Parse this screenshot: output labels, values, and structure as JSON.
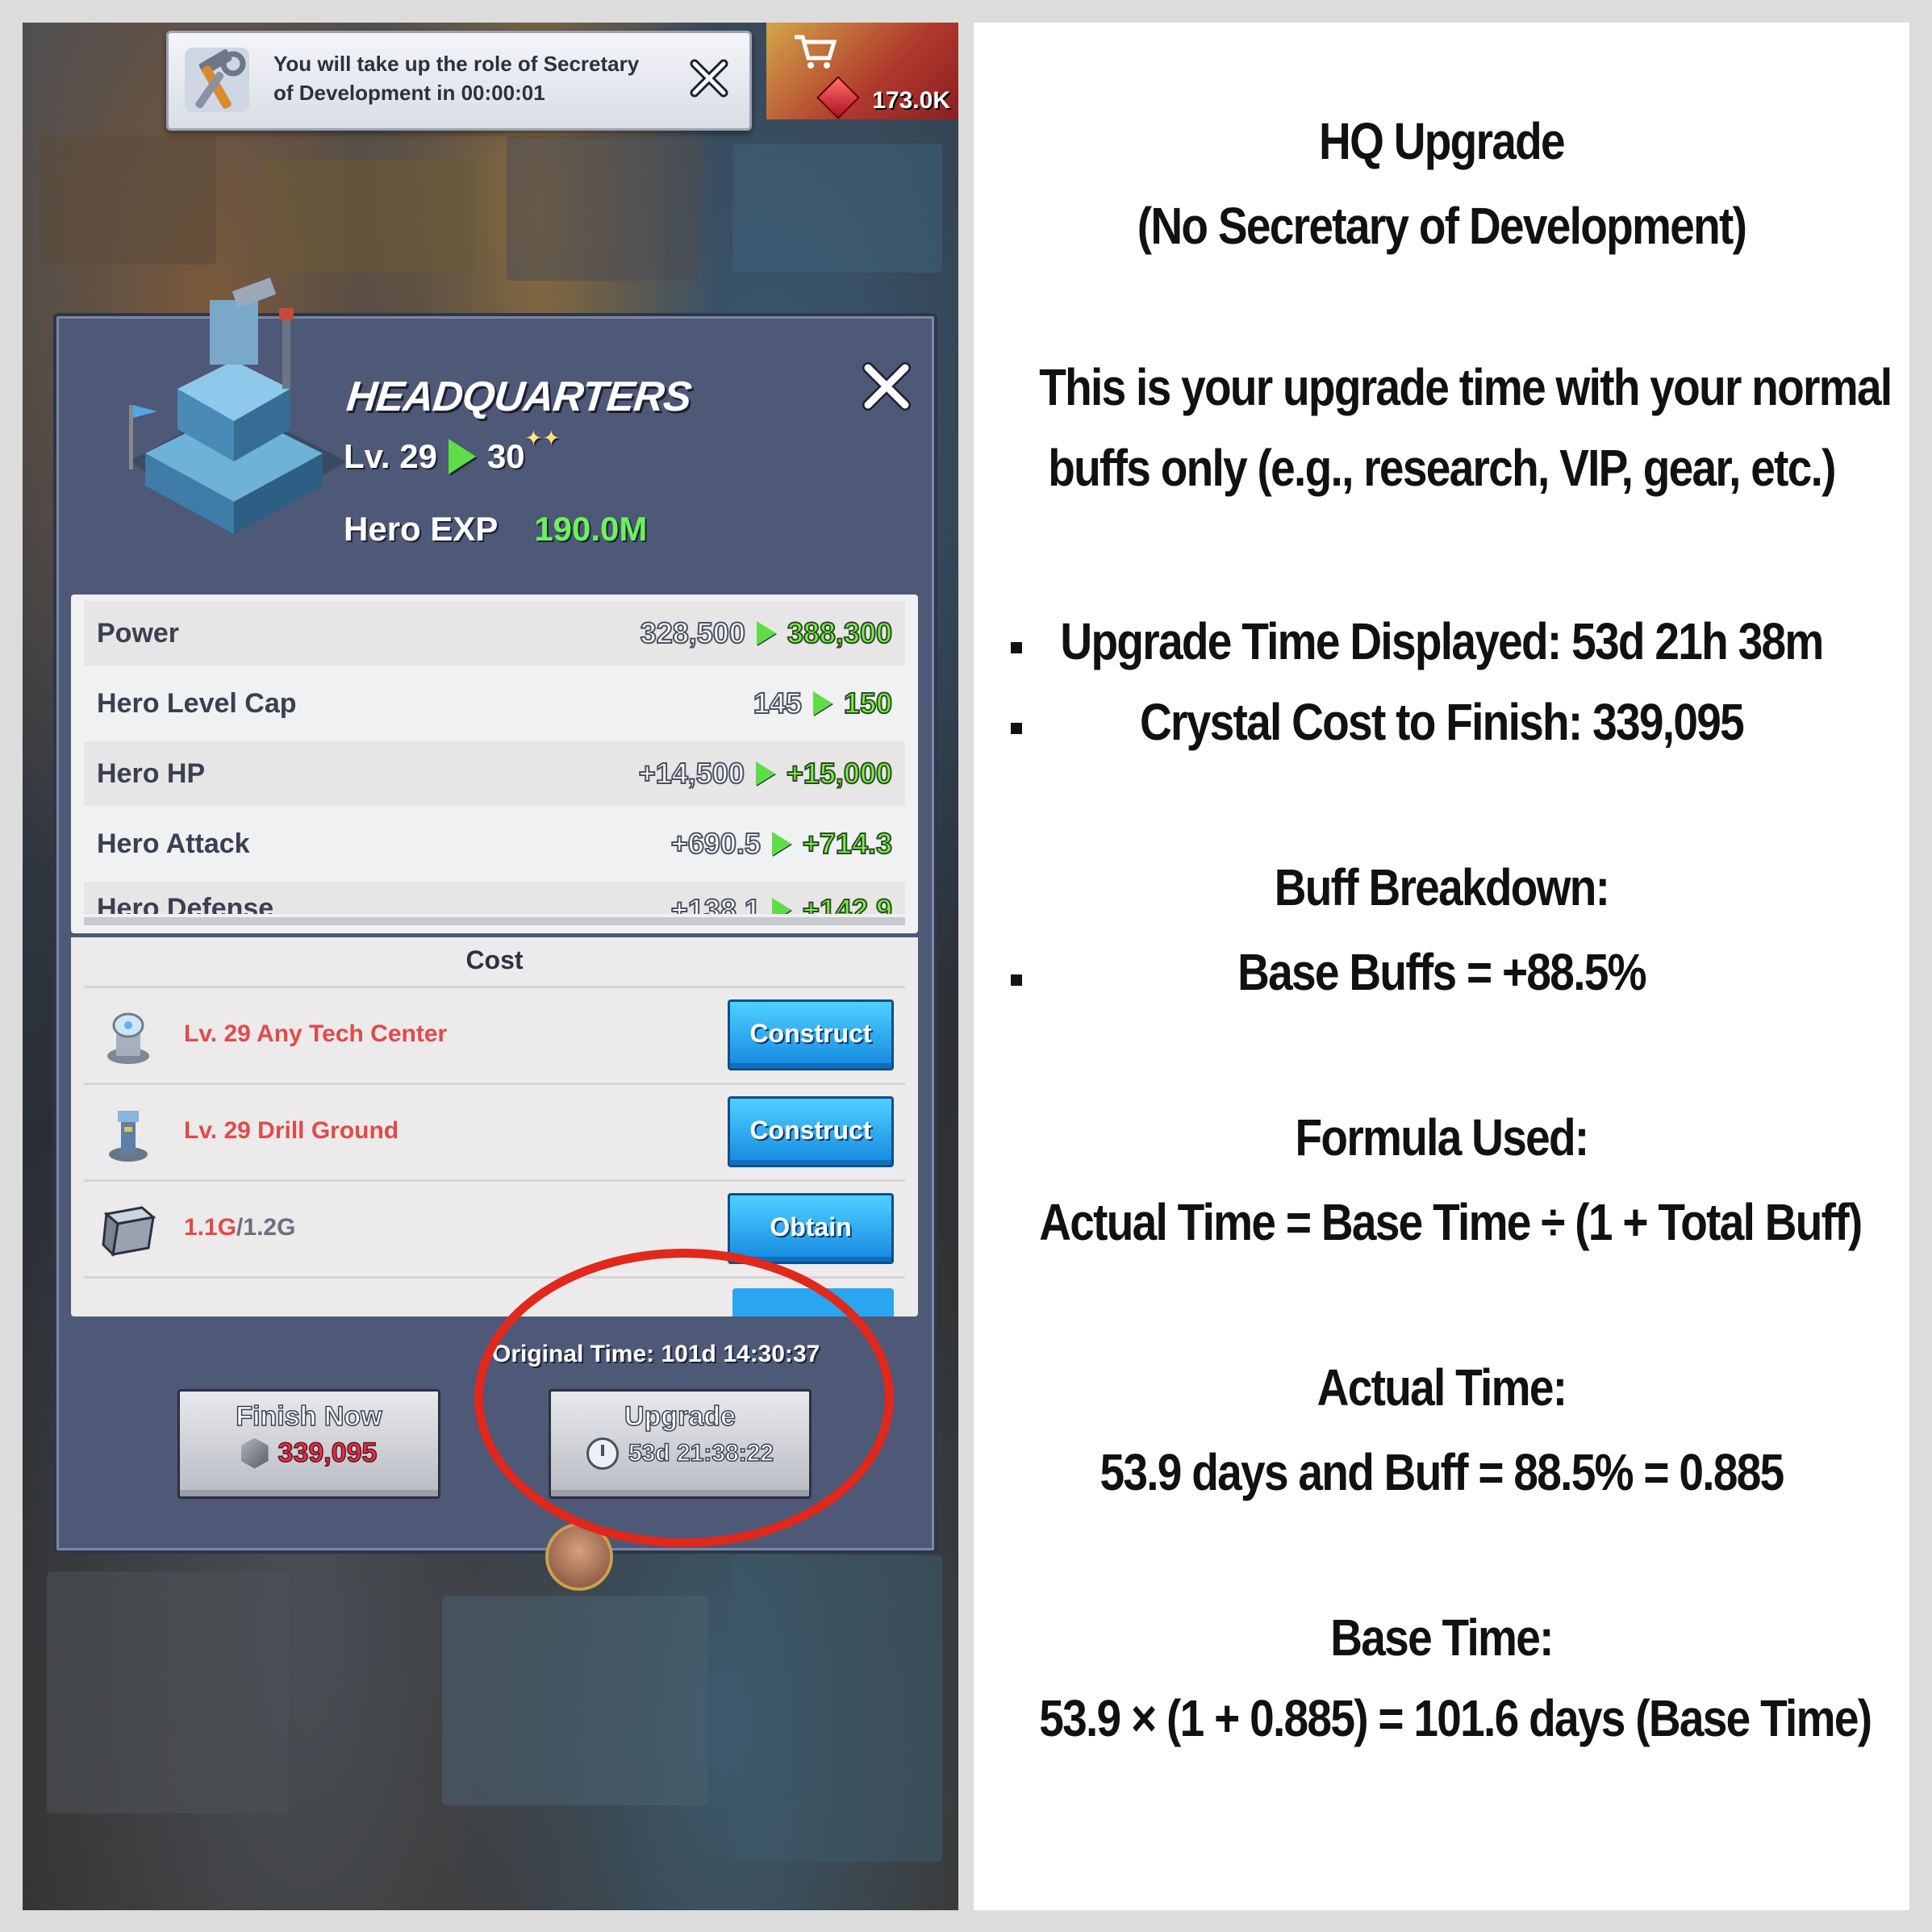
{
  "game": {
    "notification": {
      "text": "You will take up the role of Secretary of Development in 00:00:01"
    },
    "shop": {
      "crystals": "173.0K"
    },
    "panel": {
      "title": "HEADQUARTERS",
      "level_prefix": "Lv. 29",
      "level_next": "30",
      "hero_exp_label": "Hero EXP",
      "hero_exp_value": "190.0M",
      "stats": [
        {
          "name": "Power",
          "from": "328,500",
          "to": "388,300"
        },
        {
          "name": "Hero Level Cap",
          "from": "145",
          "to": "150"
        },
        {
          "name": "Hero HP",
          "from": "+14,500",
          "to": "+15,000"
        },
        {
          "name": "Hero Attack",
          "from": "+690.5",
          "to": "+714.3"
        },
        {
          "name": "Hero Defense",
          "from": "+138.1",
          "to": "+142.9"
        }
      ],
      "cost_title": "Cost",
      "costs": [
        {
          "label": "Lv. 29 Any Tech Center",
          "button": "Construct"
        },
        {
          "label": "Lv. 29 Drill Ground",
          "button": "Construct"
        },
        {
          "have": "1.1G",
          "need": "/1.2G",
          "button": "Obtain"
        }
      ],
      "original_time": "Original Time: 101d 14:30:37",
      "finish_now_label": "Finish Now",
      "finish_now_cost": "339,095",
      "upgrade_label": "Upgrade",
      "upgrade_time": "53d 21:38:22"
    }
  },
  "notes": {
    "title": "HQ Upgrade",
    "subtitle": "(No Secretary of Development)",
    "intro_1": "This is your upgrade time with your normal",
    "intro_2": "buffs only (e.g., research, VIP, gear, etc.)",
    "bullet_1": "Upgrade Time Displayed: 53d 21h 38m",
    "bullet_2": "Crystal Cost to Finish: 339,095",
    "buff_heading": "Buff Breakdown:",
    "bullet_3": "Base Buffs = +88.5%",
    "formula_heading": "Formula Used:",
    "formula": "Actual Time = Base Time ÷ (1 + Total Buff)",
    "actual_heading": "Actual Time:",
    "actual_line": "53.9 days and Buff = 88.5% = 0.885",
    "base_heading": "Base Time:",
    "base_line": "53.9 × (1 + 0.885) = 101.6 days (Base Time)"
  }
}
